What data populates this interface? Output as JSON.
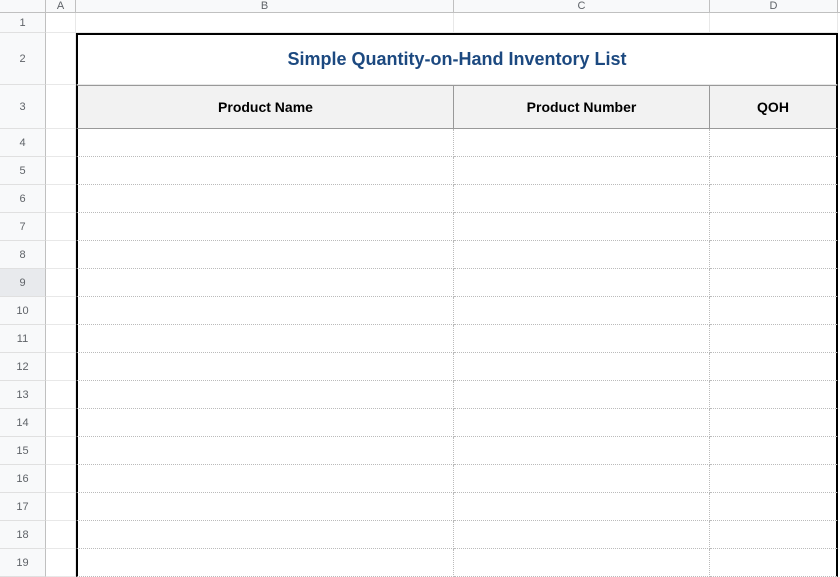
{
  "columns": {
    "A": "A",
    "B": "B",
    "C": "C",
    "D": "D"
  },
  "rows": [
    "1",
    "2",
    "3",
    "4",
    "5",
    "6",
    "7",
    "8",
    "9",
    "10",
    "11",
    "12",
    "13",
    "14",
    "15",
    "16",
    "17",
    "18",
    "19"
  ],
  "selected_row": "9",
  "title": "Simple Quantity-on-Hand Inventory List",
  "headers": {
    "product_name": "Product Name",
    "product_number": "Product Number",
    "qoh": "QOH"
  },
  "data_rows": [
    {
      "product_name": "",
      "product_number": "",
      "qoh": ""
    },
    {
      "product_name": "",
      "product_number": "",
      "qoh": ""
    },
    {
      "product_name": "",
      "product_number": "",
      "qoh": ""
    },
    {
      "product_name": "",
      "product_number": "",
      "qoh": ""
    },
    {
      "product_name": "",
      "product_number": "",
      "qoh": ""
    },
    {
      "product_name": "",
      "product_number": "",
      "qoh": ""
    },
    {
      "product_name": "",
      "product_number": "",
      "qoh": ""
    },
    {
      "product_name": "",
      "product_number": "",
      "qoh": ""
    },
    {
      "product_name": "",
      "product_number": "",
      "qoh": ""
    },
    {
      "product_name": "",
      "product_number": "",
      "qoh": ""
    },
    {
      "product_name": "",
      "product_number": "",
      "qoh": ""
    },
    {
      "product_name": "",
      "product_number": "",
      "qoh": ""
    },
    {
      "product_name": "",
      "product_number": "",
      "qoh": ""
    },
    {
      "product_name": "",
      "product_number": "",
      "qoh": ""
    },
    {
      "product_name": "",
      "product_number": "",
      "qoh": ""
    },
    {
      "product_name": "",
      "product_number": "",
      "qoh": ""
    }
  ]
}
